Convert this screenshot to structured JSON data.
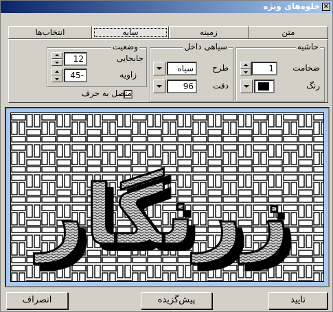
{
  "window": {
    "title": "جلوه‌های ویژه"
  },
  "tabs": [
    {
      "label": "متن"
    },
    {
      "label": "زمینه"
    },
    {
      "label": "سایه"
    },
    {
      "label": "انتخاب‌ها"
    }
  ],
  "border_group": {
    "legend": "حاشیه",
    "thickness_label": "ضخامت",
    "thickness_value": "1",
    "color_label": "رنگ",
    "color_value": "#000000"
  },
  "inner_shadow_group": {
    "legend": "سیاهی داخل",
    "pattern_label": "طرح",
    "pattern_value": "سیاه",
    "precision_label": "دقت",
    "precision_value": "96"
  },
  "position_group": {
    "legend": "وضعیت",
    "offset_label": "جابجایی",
    "offset_value": "12",
    "angle_label": "زاویه",
    "angle_value": "-45"
  },
  "attached": {
    "label": "متصل به حرف",
    "checked": false
  },
  "preview": {
    "text": "زرنگار"
  },
  "buttons": {
    "ok": "تایید",
    "default": "پیش‌گزیده",
    "cancel": "انصراف"
  },
  "colors": {
    "titlebar_start": "#0a246a",
    "titlebar_end": "#a6caf0",
    "face": "#d4d0c8",
    "preview_frame": "#a6caf0"
  }
}
